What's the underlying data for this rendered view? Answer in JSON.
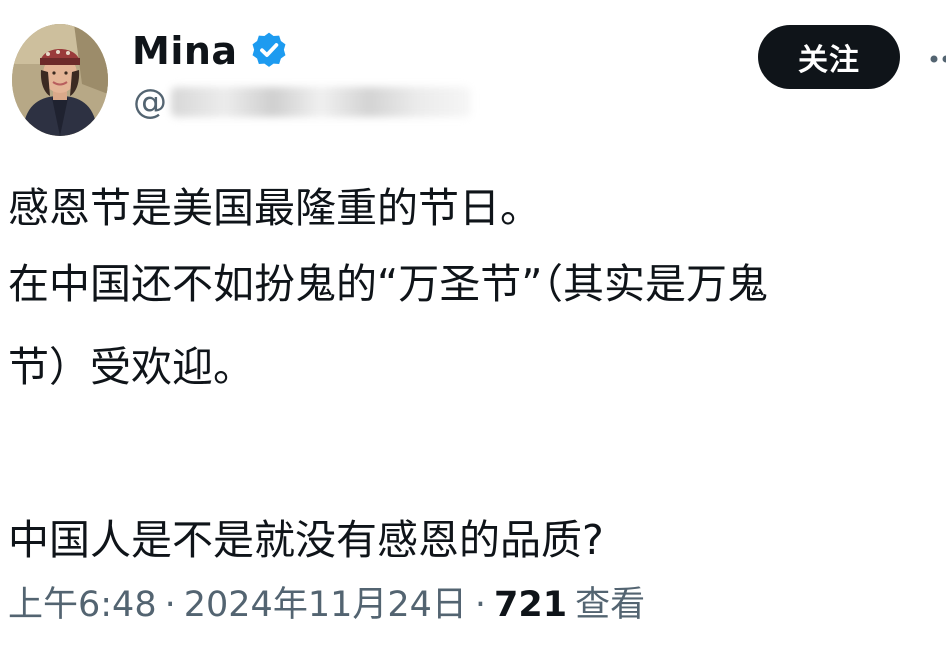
{
  "author": {
    "display_name": "Mina",
    "handle_prefix": "@",
    "follow_label": "关注",
    "verified_color": "#1d9bf0"
  },
  "tweet": {
    "lines": [
      "感恩节是美国最隆重的节日。",
      "在中国还不如扮鬼的“万圣节”（其实是万鬼",
      "节）受欢迎。",
      "中国人是不是就没有感恩的品质?"
    ]
  },
  "meta": {
    "time": "上午6:48",
    "separator": "·",
    "date": "2024年11月24日",
    "views_count": "721",
    "views_label": "查看"
  },
  "icons": {
    "verified": "verified-badge-icon",
    "more": "more-options-icon"
  }
}
